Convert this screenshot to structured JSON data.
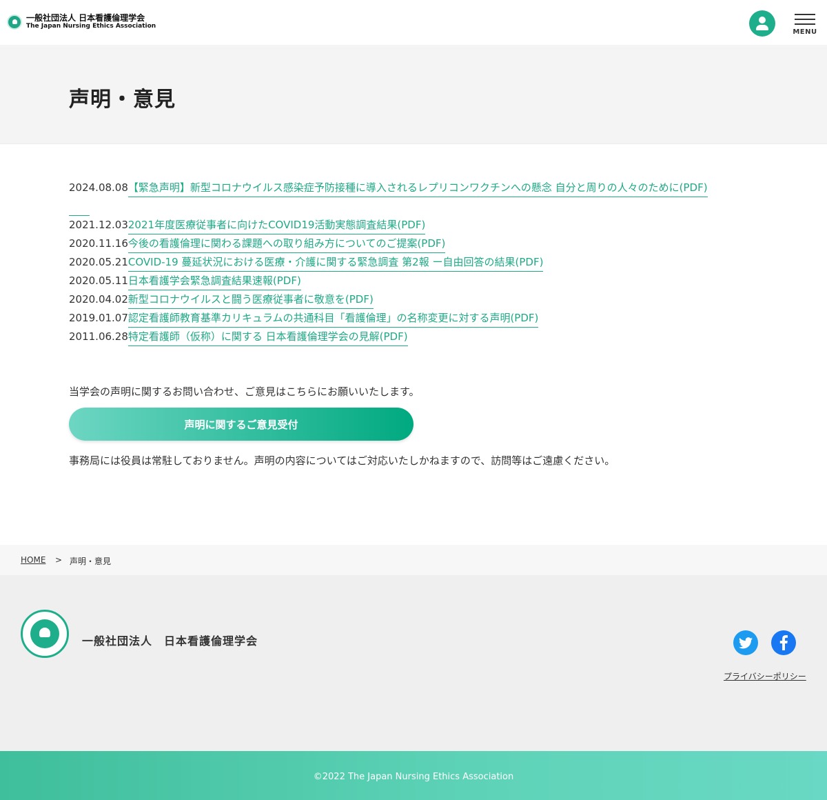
{
  "header": {
    "org_name_ja": "一般社団法人 日本看護倫理学会",
    "org_name_en": "The Japan Nursing Ethics Association",
    "menu_label": "MENU",
    "user_icon": "user-icon",
    "menu_icon": "hamburger-icon"
  },
  "page": {
    "title": "声明・意見"
  },
  "statements": [
    {
      "date": "2024.08.08",
      "text": "【緊急声明】新型コロナウイルス感染症予防接種に導入されるレプリコンワクチンへの懸念 自分と周りの人々のために(PDF)"
    },
    {
      "date": "2021.12.03",
      "text": "2021年度医療従事者に向けたCOVID19活動実態調査結果(PDF)"
    },
    {
      "date": "2020.11.16",
      "text": "今後の看護倫理に関わる課題への取り組み方についてのご提案(PDF)"
    },
    {
      "date": "2020.05.21",
      "text": "COVID-19 蔓延状況における医療・介護に関する緊急調査 第2報 ー自由回答の結果(PDF)"
    },
    {
      "date": "2020.05.11",
      "text": "日本看護学会緊急調査結果速報(PDF)"
    },
    {
      "date": "2020.04.02",
      "text": "新型コロナウイルスと闘う医療従事者に敬意を(PDF)"
    },
    {
      "date": "2019.01.07",
      "text": "認定看護師教育基準カリキュラムの共通科目「看護倫理」の名称変更に対する声明(PDF)"
    },
    {
      "date": "2011.06.28",
      "text": "特定看護師（仮称）に関する 日本看護倫理学会の見解(PDF)"
    }
  ],
  "contact": {
    "notice": "当学会の声明に関するお問い合わせ、ご意見はこちらにお願いいたします。",
    "button_label": "声明に関するご意見受付",
    "note": "事務局には役員は常駐しておりません。声明の内容についてはご対応いたしかねますので、訪問等はご遠慮ください。"
  },
  "breadcrumb": {
    "home": "HOME",
    "separator": ">",
    "current": "声明・意見"
  },
  "footer": {
    "org_name": "一般社団法人　日本看護倫理学会",
    "privacy": "プライバシーポリシー",
    "twitter_icon": "twitter-icon",
    "facebook_icon": "facebook-icon",
    "copyright": "©2022 The Japan Nursing Ethics Association"
  },
  "colors": {
    "accent": "#1fa986",
    "twitter": "#1d9bf0",
    "facebook": "#1877f2"
  }
}
